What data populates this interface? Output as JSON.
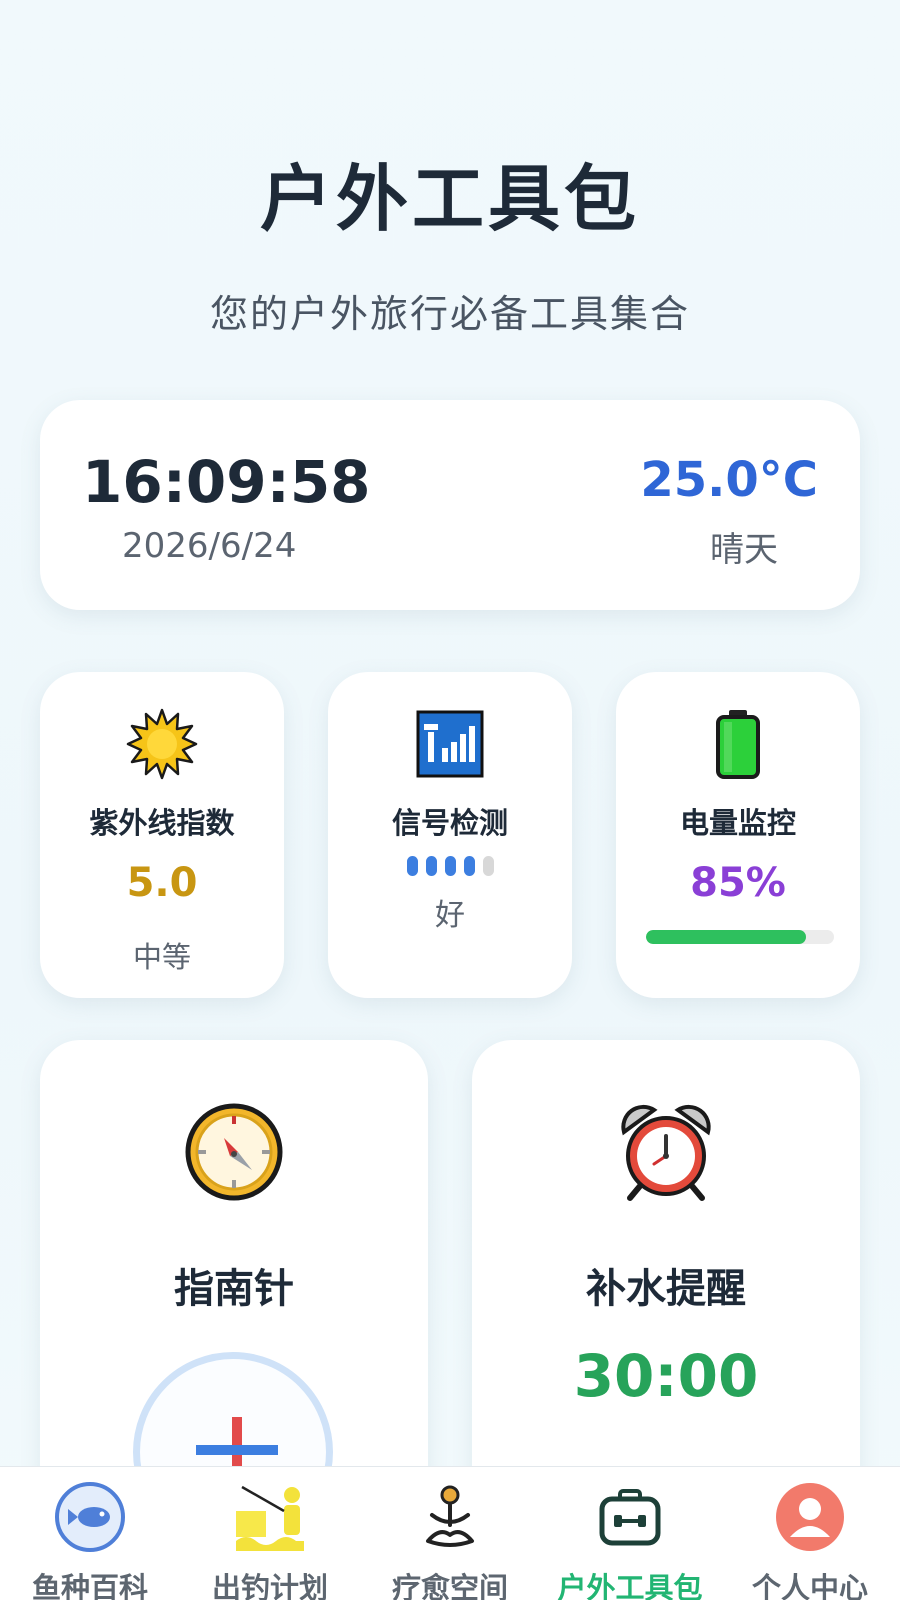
{
  "header": {
    "title": "户外工具包",
    "subtitle": "您的户外旅行必备工具集合"
  },
  "time_card": {
    "time": "16:09:58",
    "date": "2026/6/24",
    "temperature": "25.0°C",
    "weather": "晴天"
  },
  "uv": {
    "icon": "sun-icon",
    "title": "紫外线指数",
    "value": "5.0",
    "level": "中等"
  },
  "signal": {
    "icon": "signal-antenna-icon",
    "title": "信号检测",
    "bars_total": 5,
    "bars_active": 4,
    "quality": "好"
  },
  "battery": {
    "icon": "battery-icon",
    "title": "电量监控",
    "value": "85%",
    "level_fraction": 0.85
  },
  "compass": {
    "icon": "compass-icon",
    "title": "指南针"
  },
  "hydration": {
    "icon": "alarm-clock-icon",
    "title": "补水提醒",
    "timer": "30:00"
  },
  "nav": {
    "items": [
      {
        "label": "鱼种百科",
        "icon": "fish-icon",
        "active": false
      },
      {
        "label": "出钓计划",
        "icon": "fishing-person-icon",
        "active": false
      },
      {
        "label": "疗愈空间",
        "icon": "meditation-icon",
        "active": false
      },
      {
        "label": "户外工具包",
        "icon": "toolbox-icon",
        "active": true
      },
      {
        "label": "个人中心",
        "icon": "user-icon",
        "active": false
      }
    ]
  },
  "colors": {
    "accent_green": "#22b573",
    "temperature_blue": "#2f66d6",
    "uv_gold": "#c89612",
    "battery_purple": "#8a3fd6",
    "timer_green": "#27a35a"
  }
}
